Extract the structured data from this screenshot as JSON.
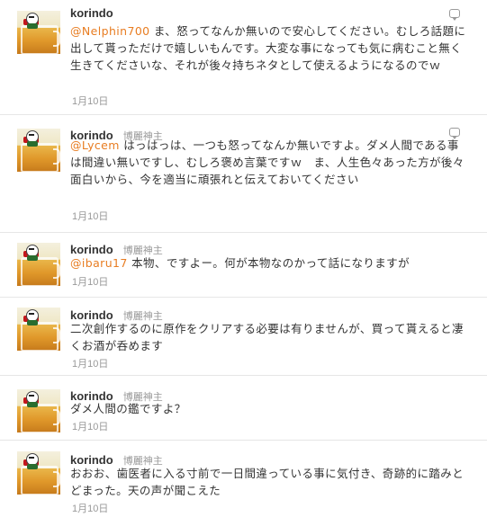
{
  "tweets": [
    {
      "username": "korindo",
      "display_name": "",
      "mention": "@Nelphin700",
      "text": " ま、怒ってなんか無いので安心してください。むしろ話題に出して貰っただけで嬉しいもんです。大変な事になっても気に病むこと無く生きてくださいな、それが後々持ちネタとして使えるようになるのでｗ",
      "timestamp": "1月10日"
    },
    {
      "username": "korindo",
      "display_name": "博麗神主",
      "mention": "@Lycem",
      "text": " はっはっは、一つも怒ってなんか無いですよ。ダメ人間である事は間違い無いですし、むしろ褒め言葉ですｗ　ま、人生色々あった方が後々面白いから、今を適当に頑張れと伝えておいてください",
      "timestamp": "1月10日"
    },
    {
      "username": "korindo",
      "display_name": "博麗神主",
      "mention": "@ibaru17",
      "text": " 本物、ですよー。何が本物なのかって話になりますが",
      "timestamp": "1月10日"
    },
    {
      "username": "korindo",
      "display_name": "博麗神主",
      "mention": "",
      "text": "二次創作するのに原作をクリアする必要は有りませんが、買って貰えると凄くお酒が呑めます",
      "timestamp": "1月10日"
    },
    {
      "username": "korindo",
      "display_name": "博麗神主",
      "mention": "",
      "text": "ダメ人間の鑑ですよ？",
      "timestamp": "1月10日"
    },
    {
      "username": "korindo",
      "display_name": "博麗神主",
      "mention": "",
      "text": "おおお、歯医者に入る寸前で一日間違っている事に気付き、奇跡的に踏みとどまった。天の声が聞こえた",
      "timestamp": "1月10日"
    }
  ]
}
